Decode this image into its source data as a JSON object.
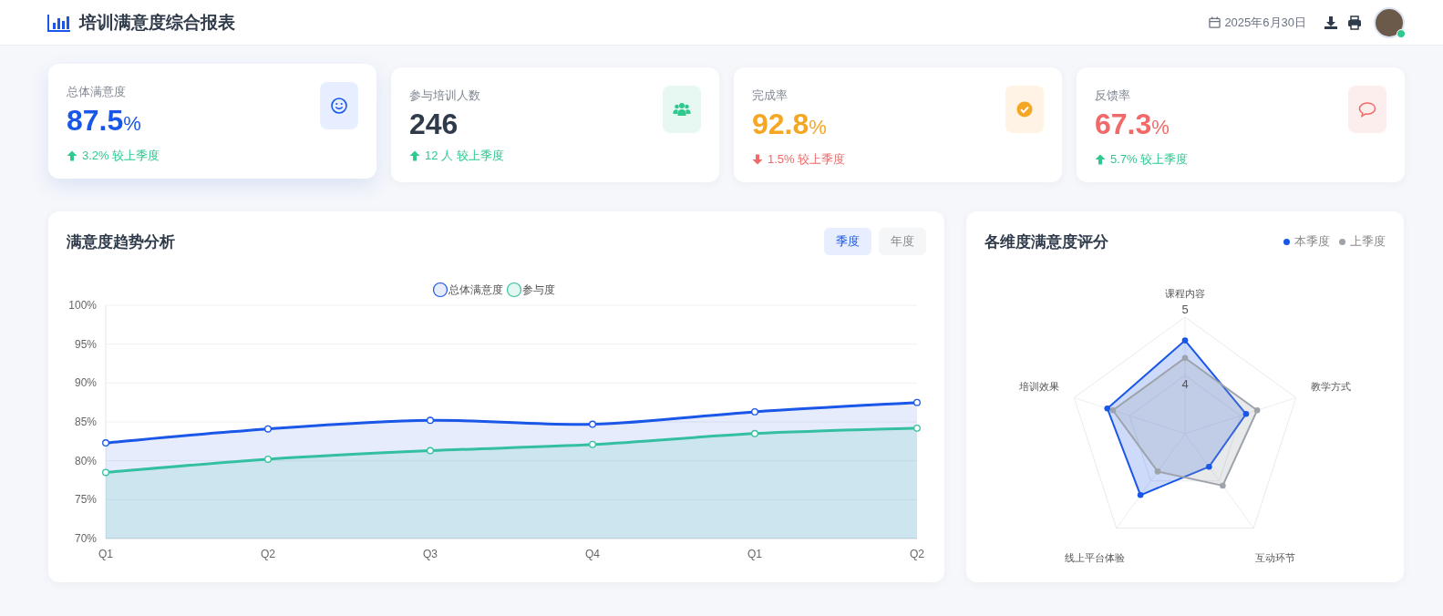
{
  "header": {
    "title": "培训满意度综合报表",
    "date": "2025年6月30日",
    "user": {
      "online": true
    }
  },
  "stats": [
    {
      "label": "总体满意度",
      "value": "87.5",
      "unit": "%",
      "change": "3.2% 较上季度",
      "rising": true,
      "kind": "smile",
      "color": "#1a56e8",
      "raised": true
    },
    {
      "label": "参与培训人数",
      "value": "246",
      "change": "12 人 较上季度",
      "rising": true,
      "kind": "users",
      "color": "#2f3a4a",
      "raised": false
    },
    {
      "label": "完成率",
      "value": "92.8",
      "unit": "%",
      "change": "1.5% 较上季度",
      "rising": false,
      "kind": "check",
      "color": "#f5a623",
      "raised": false
    },
    {
      "label": "反馈率",
      "value": "67.3",
      "unit": "%",
      "change": "5.7% 较上季度",
      "rising": true,
      "kind": "comment",
      "color": "#f06a6a",
      "raised": false
    }
  ],
  "trend_panel": {
    "title": "满意度趋势分析",
    "toggles": [
      {
        "label": "季度",
        "selected": true
      },
      {
        "label": "年度",
        "selected": false
      }
    ],
    "chart_data": {
      "type": "area",
      "categories": [
        "Q1",
        "Q2",
        "Q3",
        "Q4",
        "Q1",
        "Q2"
      ],
      "ylim": [
        70,
        100
      ],
      "grid": true,
      "legend": true,
      "yticks": [
        {
          "value": 70,
          "label": "70%"
        },
        {
          "value": 75,
          "label": "75%"
        },
        {
          "value": 80,
          "label": "80%"
        },
        {
          "value": 85,
          "label": "85%"
        },
        {
          "value": 90,
          "label": "90%"
        },
        {
          "value": 95,
          "label": "95%"
        },
        {
          "value": 100,
          "label": "100%"
        }
      ],
      "series": [
        {
          "name": "总体满意度",
          "color": "#1a56e8",
          "values": [
            82.3,
            84.1,
            85.2,
            84.7,
            86.3,
            87.5
          ]
        },
        {
          "name": "参与度",
          "color": "#34c0a0",
          "values": [
            78.5,
            80.2,
            81.3,
            82.1,
            83.5,
            84.2
          ]
        }
      ]
    }
  },
  "radar_panel": {
    "title": "各维度满意度评分",
    "chart_data": {
      "type": "radar",
      "categories": [
        "课程内容",
        "教学方式",
        "互动环节",
        "线上平台体验",
        "培训效果"
      ],
      "ylim": [
        3,
        5
      ],
      "yticks": [
        4,
        5
      ],
      "series": [
        {
          "name": "本季度",
          "color": "#1a56e8",
          "values": [
            4.6,
            4.1,
            3.7,
            4.3,
            4.4
          ]
        },
        {
          "name": "上季度",
          "color": "#9ea3ab",
          "values": [
            4.3,
            4.3,
            4.1,
            3.8,
            4.3
          ]
        }
      ]
    }
  }
}
